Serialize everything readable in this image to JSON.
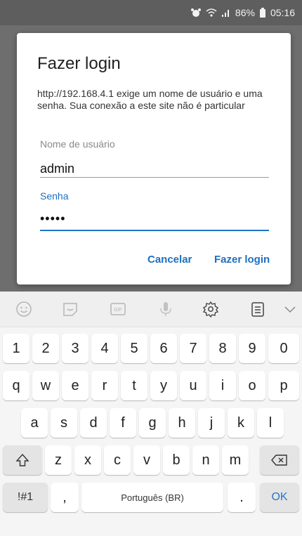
{
  "status_bar": {
    "battery": "86%",
    "time": "05:16",
    "icons": [
      "alarm-icon",
      "wifi-icon",
      "signal-icon",
      "battery-icon"
    ]
  },
  "dialog": {
    "title": "Fazer login",
    "message": "http://192.168.4.1 exige um nome de usuário e uma senha. Sua conexão a este site não é particular",
    "username_label": "Nome de usuário",
    "username_value": "admin",
    "password_label": "Senha",
    "password_value": "•••••",
    "cancel_label": "Cancelar",
    "login_label": "Fazer login"
  },
  "keyboard": {
    "toolbar_icons": [
      "emoji-icon",
      "sticker-icon",
      "gif-icon",
      "microphone-icon",
      "settings-gear-icon",
      "clipboard-icon",
      "chevron-down-icon"
    ],
    "number_row": [
      "1",
      "2",
      "3",
      "4",
      "5",
      "6",
      "7",
      "8",
      "9",
      "0"
    ],
    "row1": [
      "q",
      "w",
      "e",
      "r",
      "t",
      "y",
      "u",
      "i",
      "o",
      "p"
    ],
    "row2": [
      "a",
      "s",
      "d",
      "f",
      "g",
      "h",
      "j",
      "k",
      "l"
    ],
    "row3": [
      "z",
      "x",
      "c",
      "v",
      "b",
      "n",
      "m"
    ],
    "symbols_label": "!#1",
    "comma_label": ",",
    "space_label": "Português (BR)",
    "period_label": ".",
    "ok_label": "OK"
  }
}
